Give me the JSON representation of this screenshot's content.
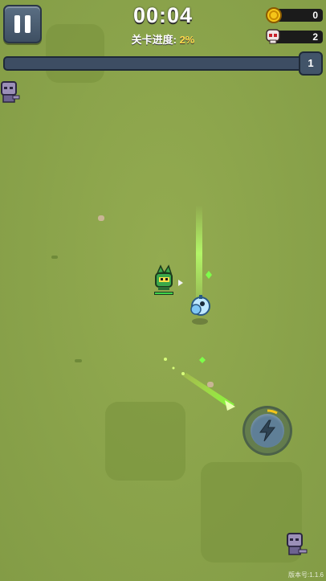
{
  "hud": {
    "timer": "00:04",
    "stage_progress_label": "关卡进度:",
    "stage_progress_value": "2%",
    "coins": "0",
    "kills": "2",
    "level": "1",
    "xp_fraction": 0.0
  },
  "footer": {
    "version": "版本号:1.1.6"
  },
  "icons": {
    "pause": "pause-icon",
    "coin": "coin-icon",
    "skull": "skull-icon",
    "skill": "lightning-icon"
  },
  "colors": {
    "grass": "#8aa34b",
    "progress_pct": "#ffd84a",
    "laser": "#b6ff6a"
  }
}
